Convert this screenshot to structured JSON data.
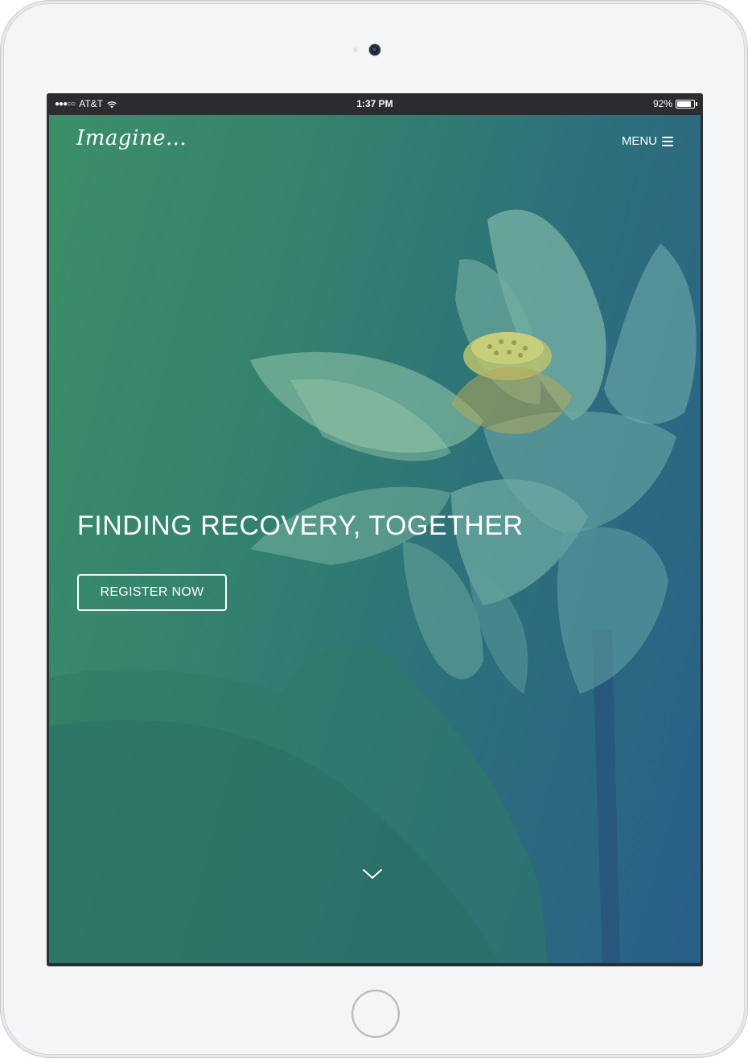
{
  "status_bar": {
    "signal_dots": "●●●○○",
    "carrier": "AT&T",
    "time": "1:37 PM",
    "battery_percent": "92%",
    "battery_level": 0.92,
    "wifi_icon": "wifi-icon"
  },
  "header": {
    "brand": "Imagine...",
    "menu_label": "MENU",
    "menu_icon": "hamburger-icon"
  },
  "hero": {
    "headline": "FINDING RECOVERY, TOGETHER",
    "cta_label": "REGISTER NOW",
    "scroll_icon": "chevron-down-icon",
    "background_image": "lotus flower photo with green-to-blue gradient overlay"
  },
  "colors": {
    "gradient_start": "#3b8f68",
    "gradient_end": "#2a5f88",
    "text": "#ffffff",
    "device_frame": "#f4f5f7"
  }
}
